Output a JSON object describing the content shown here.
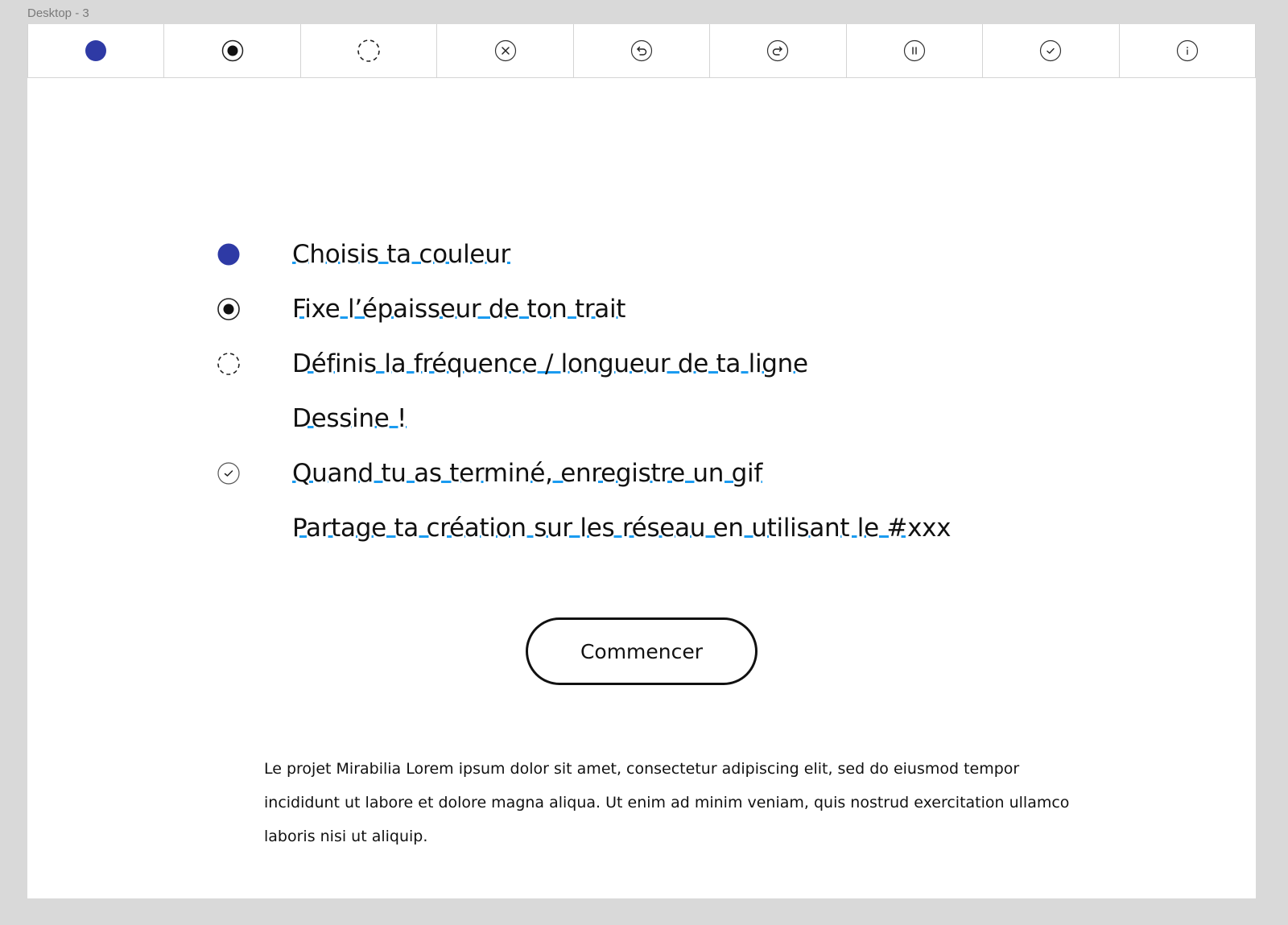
{
  "frame": {
    "label": "Desktop - 3"
  },
  "colors": {
    "accent": "#2e3aa5",
    "underline": "#1a9bf0",
    "text": "#111111",
    "canvas": "#d9d9d9"
  },
  "toolbar": {
    "tools": [
      {
        "icon": "color-dot-icon"
      },
      {
        "icon": "stroke-width-icon"
      },
      {
        "icon": "dashed-circle-icon"
      },
      {
        "icon": "clear-icon"
      },
      {
        "icon": "undo-icon"
      },
      {
        "icon": "redo-icon"
      },
      {
        "icon": "pause-icon"
      },
      {
        "icon": "check-icon"
      },
      {
        "icon": "info-icon"
      }
    ]
  },
  "steps": [
    {
      "icon": "color-dot-icon",
      "text": "Choisis ta couleur"
    },
    {
      "icon": "stroke-width-icon",
      "text": "Fixe l’épaisseur de ton trait"
    },
    {
      "icon": "dashed-circle-icon",
      "text": "Définis la fréquence / longueur de ta ligne"
    },
    {
      "icon": "",
      "text": "Dessine !"
    },
    {
      "icon": "check-icon",
      "text": "Quand tu as terminé, enregistre un gif"
    },
    {
      "icon": "",
      "text": "Partage ta création sur les réseau en utilisant le #xxx"
    }
  ],
  "start_button": {
    "label": "Commencer"
  },
  "description": "Le projet Mirabilia Lorem ipsum dolor sit amet, consectetur adipiscing elit, sed do eiusmod tempor incididunt ut labore et dolore magna aliqua. Ut enim ad minim veniam, quis nostrud exercitation ullamco laboris nisi ut aliquip."
}
